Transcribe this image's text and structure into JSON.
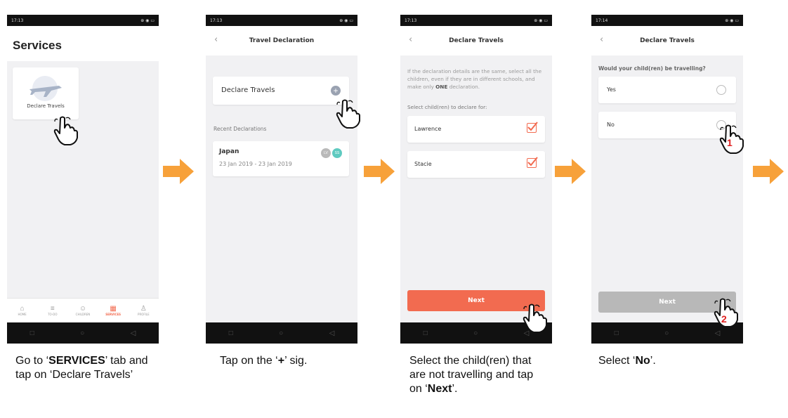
{
  "screen1": {
    "time": "17:13",
    "icons": "⊕ ◉ ▭",
    "title": "Services",
    "tile_label": "Declare Travels",
    "tabs": [
      "HOME",
      "TO-DO",
      "CHILDREN",
      "SERVICES",
      "PROFILE"
    ],
    "active_tab": "SERVICES",
    "caption_pre": "Go to ‘",
    "caption_bold": "SERVICES",
    "caption_post": "’ tab and tap on ‘Declare Travels’"
  },
  "screen2": {
    "time": "17:13",
    "icons": "⊕ ◉ ▭",
    "header_title": "Travel Declaration",
    "declare_label": "Declare Travels",
    "recent_heading": "Recent Declarations",
    "recent_item": {
      "destination": "Japan",
      "dates": "23 Jan 2019 - 23 Jan 2019",
      "avatars": [
        "LV",
        "SS"
      ]
    },
    "caption_pre": "Tap on the ‘",
    "caption_bold": "+",
    "caption_post": "’ sig."
  },
  "screen3": {
    "time": "17:13",
    "icons": "⊕ ◉ ▭",
    "header_title": "Declare Travels",
    "info_pre": "If the declaration details are the same, select all the children, even if they are in different schools, and make only ",
    "info_bold": "ONE",
    "info_post": " declaration.",
    "select_label": "Select child(ren) to declare for:",
    "children": [
      "Lawrence",
      "Stacie"
    ],
    "next_label": "Next",
    "caption_pre": "Select the child(ren) that are not travelling and tap on ‘",
    "caption_bold": "Next",
    "caption_post": "’."
  },
  "screen4": {
    "time": "17:14",
    "icons": "⊕ ◉ ▭",
    "header_title": "Declare Travels",
    "question": "Would your child(ren) be travelling?",
    "options": [
      "Yes",
      "No"
    ],
    "next_label": "Next",
    "step1": "1",
    "step2": "2",
    "caption_pre": "Select ‘",
    "caption_bold": "No",
    "caption_post": "’."
  },
  "colors": {
    "accent": "#f26b50",
    "arrow": "#f7a13a",
    "disabled": "#b8b8b8",
    "avatar_lv": "#b9b9b9",
    "avatar_ss": "#5fcac0"
  }
}
